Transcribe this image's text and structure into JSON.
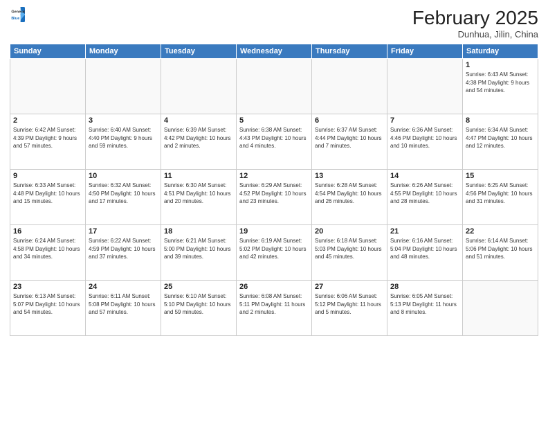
{
  "header": {
    "logo_general": "General",
    "logo_blue": "Blue",
    "month_title": "February 2025",
    "location": "Dunhua, Jilin, China"
  },
  "weekdays": [
    "Sunday",
    "Monday",
    "Tuesday",
    "Wednesday",
    "Thursday",
    "Friday",
    "Saturday"
  ],
  "weeks": [
    [
      {
        "day": "",
        "info": ""
      },
      {
        "day": "",
        "info": ""
      },
      {
        "day": "",
        "info": ""
      },
      {
        "day": "",
        "info": ""
      },
      {
        "day": "",
        "info": ""
      },
      {
        "day": "",
        "info": ""
      },
      {
        "day": "1",
        "info": "Sunrise: 6:43 AM\nSunset: 4:38 PM\nDaylight: 9 hours\nand 54 minutes."
      }
    ],
    [
      {
        "day": "2",
        "info": "Sunrise: 6:42 AM\nSunset: 4:39 PM\nDaylight: 9 hours\nand 57 minutes."
      },
      {
        "day": "3",
        "info": "Sunrise: 6:40 AM\nSunset: 4:40 PM\nDaylight: 9 hours\nand 59 minutes."
      },
      {
        "day": "4",
        "info": "Sunrise: 6:39 AM\nSunset: 4:42 PM\nDaylight: 10 hours\nand 2 minutes."
      },
      {
        "day": "5",
        "info": "Sunrise: 6:38 AM\nSunset: 4:43 PM\nDaylight: 10 hours\nand 4 minutes."
      },
      {
        "day": "6",
        "info": "Sunrise: 6:37 AM\nSunset: 4:44 PM\nDaylight: 10 hours\nand 7 minutes."
      },
      {
        "day": "7",
        "info": "Sunrise: 6:36 AM\nSunset: 4:46 PM\nDaylight: 10 hours\nand 10 minutes."
      },
      {
        "day": "8",
        "info": "Sunrise: 6:34 AM\nSunset: 4:47 PM\nDaylight: 10 hours\nand 12 minutes."
      }
    ],
    [
      {
        "day": "9",
        "info": "Sunrise: 6:33 AM\nSunset: 4:48 PM\nDaylight: 10 hours\nand 15 minutes."
      },
      {
        "day": "10",
        "info": "Sunrise: 6:32 AM\nSunset: 4:50 PM\nDaylight: 10 hours\nand 17 minutes."
      },
      {
        "day": "11",
        "info": "Sunrise: 6:30 AM\nSunset: 4:51 PM\nDaylight: 10 hours\nand 20 minutes."
      },
      {
        "day": "12",
        "info": "Sunrise: 6:29 AM\nSunset: 4:52 PM\nDaylight: 10 hours\nand 23 minutes."
      },
      {
        "day": "13",
        "info": "Sunrise: 6:28 AM\nSunset: 4:54 PM\nDaylight: 10 hours\nand 26 minutes."
      },
      {
        "day": "14",
        "info": "Sunrise: 6:26 AM\nSunset: 4:55 PM\nDaylight: 10 hours\nand 28 minutes."
      },
      {
        "day": "15",
        "info": "Sunrise: 6:25 AM\nSunset: 4:56 PM\nDaylight: 10 hours\nand 31 minutes."
      }
    ],
    [
      {
        "day": "16",
        "info": "Sunrise: 6:24 AM\nSunset: 4:58 PM\nDaylight: 10 hours\nand 34 minutes."
      },
      {
        "day": "17",
        "info": "Sunrise: 6:22 AM\nSunset: 4:59 PM\nDaylight: 10 hours\nand 37 minutes."
      },
      {
        "day": "18",
        "info": "Sunrise: 6:21 AM\nSunset: 5:00 PM\nDaylight: 10 hours\nand 39 minutes."
      },
      {
        "day": "19",
        "info": "Sunrise: 6:19 AM\nSunset: 5:02 PM\nDaylight: 10 hours\nand 42 minutes."
      },
      {
        "day": "20",
        "info": "Sunrise: 6:18 AM\nSunset: 5:03 PM\nDaylight: 10 hours\nand 45 minutes."
      },
      {
        "day": "21",
        "info": "Sunrise: 6:16 AM\nSunset: 5:04 PM\nDaylight: 10 hours\nand 48 minutes."
      },
      {
        "day": "22",
        "info": "Sunrise: 6:14 AM\nSunset: 5:06 PM\nDaylight: 10 hours\nand 51 minutes."
      }
    ],
    [
      {
        "day": "23",
        "info": "Sunrise: 6:13 AM\nSunset: 5:07 PM\nDaylight: 10 hours\nand 54 minutes."
      },
      {
        "day": "24",
        "info": "Sunrise: 6:11 AM\nSunset: 5:08 PM\nDaylight: 10 hours\nand 57 minutes."
      },
      {
        "day": "25",
        "info": "Sunrise: 6:10 AM\nSunset: 5:10 PM\nDaylight: 10 hours\nand 59 minutes."
      },
      {
        "day": "26",
        "info": "Sunrise: 6:08 AM\nSunset: 5:11 PM\nDaylight: 11 hours\nand 2 minutes."
      },
      {
        "day": "27",
        "info": "Sunrise: 6:06 AM\nSunset: 5:12 PM\nDaylight: 11 hours\nand 5 minutes."
      },
      {
        "day": "28",
        "info": "Sunrise: 6:05 AM\nSunset: 5:13 PM\nDaylight: 11 hours\nand 8 minutes."
      },
      {
        "day": "",
        "info": ""
      }
    ]
  ]
}
